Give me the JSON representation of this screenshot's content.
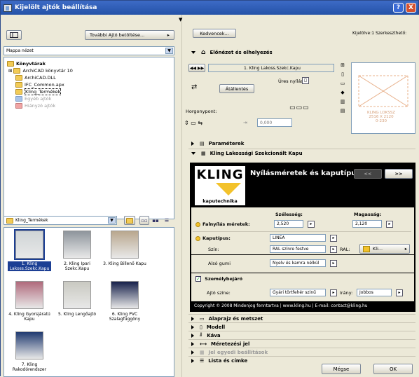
{
  "window": {
    "title": "Kijelölt ajtók beállítása",
    "help": "?",
    "close": "X"
  },
  "left": {
    "settings_button": "További Ajtó betöltése...",
    "view_select": "Mappa nézet",
    "tree": [
      {
        "label": "Könyvtárak",
        "bold": true,
        "indent": 0,
        "kind": "root"
      },
      {
        "label": "ArchiCAD könyvtár 10",
        "indent": 1,
        "kind": "plus"
      },
      {
        "label": "ArchiCAD.DLL",
        "indent": 1,
        "kind": "norm"
      },
      {
        "label": "IFC_Common.apx",
        "indent": 1,
        "kind": "norm"
      },
      {
        "label": "Kling_Termékek",
        "indent": 1,
        "kind": "norm"
      },
      {
        "label": "Egyéb ajtók",
        "indent": 1,
        "kind": "gray"
      },
      {
        "label": "Hiányzó ajtók",
        "indent": 1,
        "kind": "red"
      }
    ],
    "folder_select": "Kling_Termékek",
    "thumbnails": [
      {
        "label": "1. Kling Lakoss.Szekc.Kapu",
        "selected": true
      },
      {
        "label": "2. Kling Ipari Szekc.Kapu"
      },
      {
        "label": "3. Kling Billenő Kapu"
      },
      {
        "label": "4. Kling Gyorsjáratú Kapu"
      },
      {
        "label": "5. Kling Lengőajtó"
      },
      {
        "label": "6. Kling PVC Szalagfüggöny"
      },
      {
        "label": "7. Kling Rakodórendszer"
      }
    ]
  },
  "right": {
    "favorites_button": "Kedvencek...",
    "selection_info": "Kijelölve:1 Szerkeszthető:",
    "section_preview": "Előnézet és elhelyezés",
    "door_name": "1. Kling Lakoss.Szekc.Kapu",
    "opening_label": "Üres nyílás",
    "reflect_button": "Átállentés",
    "anchor_label": "Horgonypont:",
    "height_value": "0,000",
    "section_params": "Paraméterek",
    "section_kling": "Kling Lakossági Szekcionált Kapu",
    "preview_label": "KLING LOKSSZ\n2516 X 2120\n0-230",
    "kling": {
      "logo": "KLING",
      "subtitle": "kaputechnika",
      "header": "Nyílásméretek és kaputípus",
      "prev_btn": "<<",
      "next_btn": ">>",
      "width_label": "Szélesség:",
      "height_label": "Magasság:",
      "opening_size_label": "Falnyílás méretek:",
      "width_value": "2,520",
      "height_value": "2,120",
      "type_label": "Kaputípus:",
      "type_value": "LINEA",
      "color_label": "Szín:",
      "color_value": "RAL színre festve",
      "ral_label": "RAL:",
      "ral_value": "Kli...",
      "bottom_rubber_label": "Alsó gumi",
      "bottom_rubber_value": "Nyelv és kamra nélkül",
      "pass_door_label": "Személybejáró",
      "pass_color_label": "Ajtó színe:",
      "pass_color_value": "Gyári törtfehér szinű",
      "direction_label": "Irány:",
      "direction_value": "Jobbos",
      "footer": "Copyright © 2008 Mindenjog fenntartva  |  www.kling.hu  |  E-mail: contact@kling.hu"
    },
    "sections": [
      "Alaprajz és metszet",
      "Modell",
      "Káva",
      "Méretezési jel",
      "Jel egyedi beállítások",
      "Lista és címke"
    ],
    "cancel_button": "Mégse",
    "ok_button": "OK"
  }
}
